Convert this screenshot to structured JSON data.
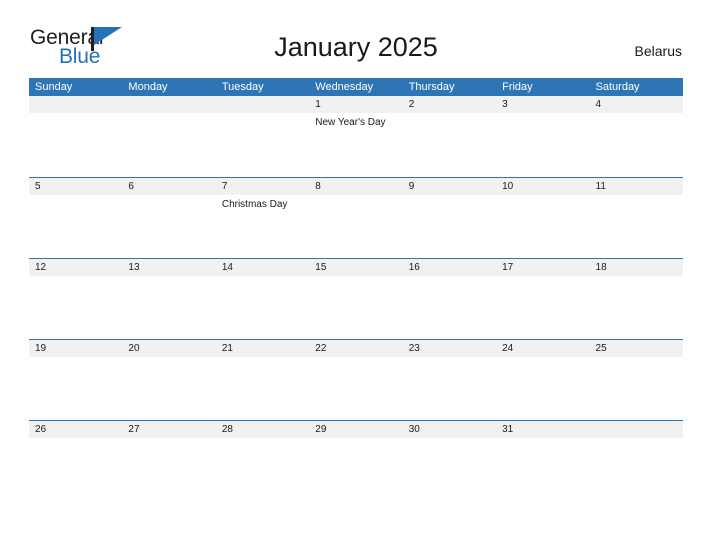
{
  "brand": {
    "name_part1": "General",
    "name_part2": "Blue",
    "primary_color": "#2472b5",
    "text_color": "#231f20"
  },
  "header": {
    "title": "January 2025",
    "country": "Belarus"
  },
  "calendar": {
    "header_bg": "#2e75b6",
    "band_bg": "#f1f1f1",
    "separator_color": "#2e75b6",
    "weekdays": [
      "Sunday",
      "Monday",
      "Tuesday",
      "Wednesday",
      "Thursday",
      "Friday",
      "Saturday"
    ],
    "weeks": [
      {
        "days": [
          {
            "date": "",
            "event": ""
          },
          {
            "date": "",
            "event": ""
          },
          {
            "date": "",
            "event": ""
          },
          {
            "date": "1",
            "event": "New Year's Day"
          },
          {
            "date": "2",
            "event": ""
          },
          {
            "date": "3",
            "event": ""
          },
          {
            "date": "4",
            "event": ""
          }
        ]
      },
      {
        "days": [
          {
            "date": "5",
            "event": ""
          },
          {
            "date": "6",
            "event": ""
          },
          {
            "date": "7",
            "event": "Christmas Day"
          },
          {
            "date": "8",
            "event": ""
          },
          {
            "date": "9",
            "event": ""
          },
          {
            "date": "10",
            "event": ""
          },
          {
            "date": "11",
            "event": ""
          }
        ]
      },
      {
        "days": [
          {
            "date": "12",
            "event": ""
          },
          {
            "date": "13",
            "event": ""
          },
          {
            "date": "14",
            "event": ""
          },
          {
            "date": "15",
            "event": ""
          },
          {
            "date": "16",
            "event": ""
          },
          {
            "date": "17",
            "event": ""
          },
          {
            "date": "18",
            "event": ""
          }
        ]
      },
      {
        "days": [
          {
            "date": "19",
            "event": ""
          },
          {
            "date": "20",
            "event": ""
          },
          {
            "date": "21",
            "event": ""
          },
          {
            "date": "22",
            "event": ""
          },
          {
            "date": "23",
            "event": ""
          },
          {
            "date": "24",
            "event": ""
          },
          {
            "date": "25",
            "event": ""
          }
        ]
      },
      {
        "days": [
          {
            "date": "26",
            "event": ""
          },
          {
            "date": "27",
            "event": ""
          },
          {
            "date": "28",
            "event": ""
          },
          {
            "date": "29",
            "event": ""
          },
          {
            "date": "30",
            "event": ""
          },
          {
            "date": "31",
            "event": ""
          },
          {
            "date": "",
            "event": ""
          }
        ]
      }
    ]
  }
}
